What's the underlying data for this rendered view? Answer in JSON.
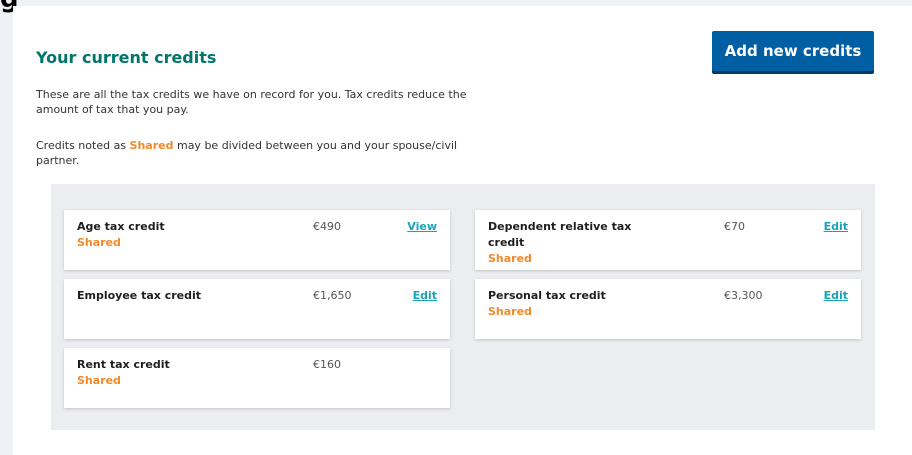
{
  "top_fragment": "g",
  "header": {
    "title": "Your current credits",
    "add_button_label": "Add new credits"
  },
  "intro": {
    "line1": "These are all the tax credits we have on record for you. Tax credits reduce the amount of tax that you pay.",
    "line2_prefix": "Credits noted as ",
    "line2_highlight": "Shared",
    "line2_suffix": " may be divided between you and your spouse/civil partner."
  },
  "credits": [
    {
      "name": "Age tax credit",
      "shared": "Shared",
      "amount": "€490",
      "action": "View"
    },
    {
      "name": "Dependent relative tax credit",
      "shared": "Shared",
      "amount": "€70",
      "action": "Edit"
    },
    {
      "name": "Employee tax credit",
      "shared": "",
      "amount": "€1,650",
      "action": "Edit"
    },
    {
      "name": "Personal tax credit",
      "shared": "Shared",
      "amount": "€3,300",
      "action": "Edit"
    },
    {
      "name": "Rent tax credit",
      "shared": "Shared",
      "amount": "€160",
      "action": ""
    }
  ],
  "colors": {
    "title": "#00756b",
    "button": "#005fa3",
    "shared": "#f28a28",
    "link": "#1aa3b8"
  }
}
